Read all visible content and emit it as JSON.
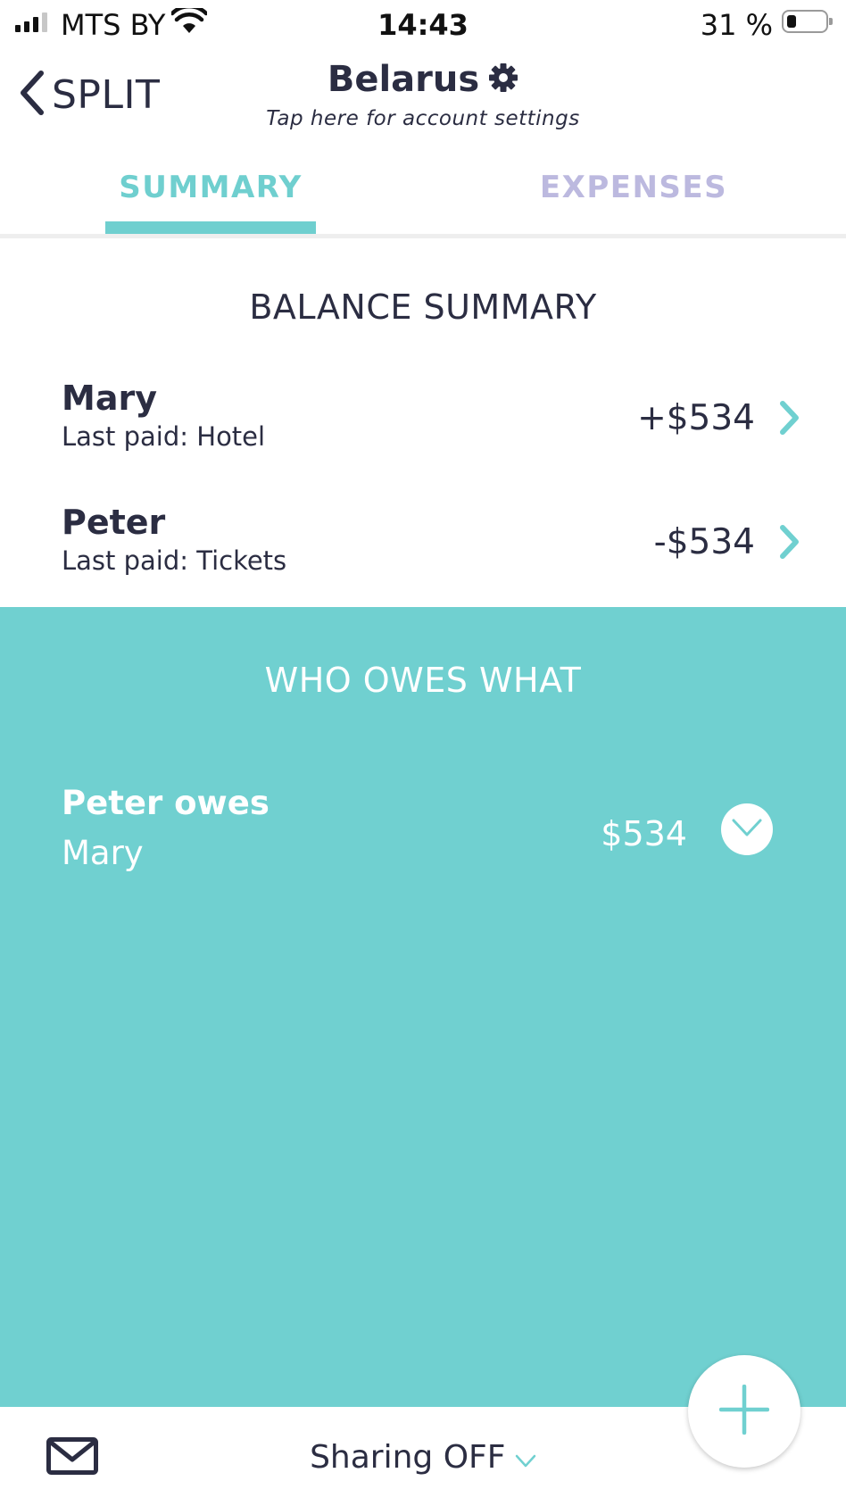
{
  "status_bar": {
    "carrier": "MTS BY",
    "time": "14:43",
    "battery": "31 %",
    "battery_level": 0.31,
    "signal_bars": 3
  },
  "nav": {
    "back_label": "SPLIT",
    "account_title": "Belarus",
    "account_subtitle": "Tap here for account settings"
  },
  "tabs": [
    {
      "label": "SUMMARY",
      "active": true
    },
    {
      "label": "EXPENSES",
      "active": false
    }
  ],
  "balance_summary": {
    "title": "BALANCE SUMMARY",
    "rows": [
      {
        "name": "Mary",
        "last_paid": "Last paid: Hotel",
        "amount": "+$534"
      },
      {
        "name": "Peter",
        "last_paid": "Last paid: Tickets",
        "amount": "-$534"
      }
    ]
  },
  "who_owes": {
    "title": "WHO OWES WHAT",
    "rows": [
      {
        "debtor": "Peter owes",
        "creditor": "Mary",
        "amount": "$534"
      }
    ]
  },
  "bottom_bar": {
    "sharing_label": "Sharing OFF"
  },
  "colors": {
    "accent": "#70d0d0",
    "inactive_tab": "#bcb9df",
    "text": "#2b2d42"
  },
  "icons": {
    "back": "chevron-left-icon",
    "settings": "gear-icon",
    "row_chevron": "chevron-right-icon",
    "expand": "chevron-down-icon",
    "mail": "mail-icon",
    "add": "plus-icon"
  }
}
